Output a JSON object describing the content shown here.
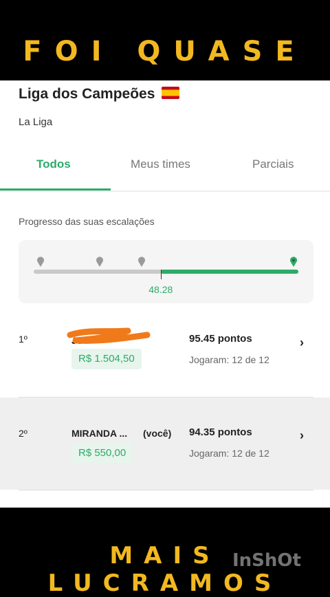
{
  "overlay": {
    "top_caption": "FOI QUASE",
    "bottom_caption": "MAIS LUCRAMOS",
    "watermark": "InShOt"
  },
  "league": {
    "title": "Liga dos Campeões",
    "flag_icon": "spain-flag-icon",
    "subtitle": "La Liga"
  },
  "tabs": [
    {
      "label": "Todos",
      "active": true
    },
    {
      "label": "Meus times",
      "active": false
    },
    {
      "label": "Parciais",
      "active": false
    }
  ],
  "progress": {
    "label": "Progresso das suas escalações",
    "value_label": "48.28",
    "fill_fraction": 0.52
  },
  "ranking": [
    {
      "rank": "1º",
      "name": "Jo",
      "you_tag": "",
      "prize": "R$ 1.504,50",
      "points": "95.45 pontos",
      "played": "Jogaram: 12 de 12"
    },
    {
      "rank": "2º",
      "name": "MIRANDA ...",
      "you_tag": "(você)",
      "prize": "R$ 550,00",
      "points": "94.35 pontos",
      "played": "Jogaram: 12 de 12"
    }
  ],
  "colors": {
    "accent": "#2eaa6a",
    "caption": "#f2b81f",
    "scribble": "#f07a1a"
  }
}
